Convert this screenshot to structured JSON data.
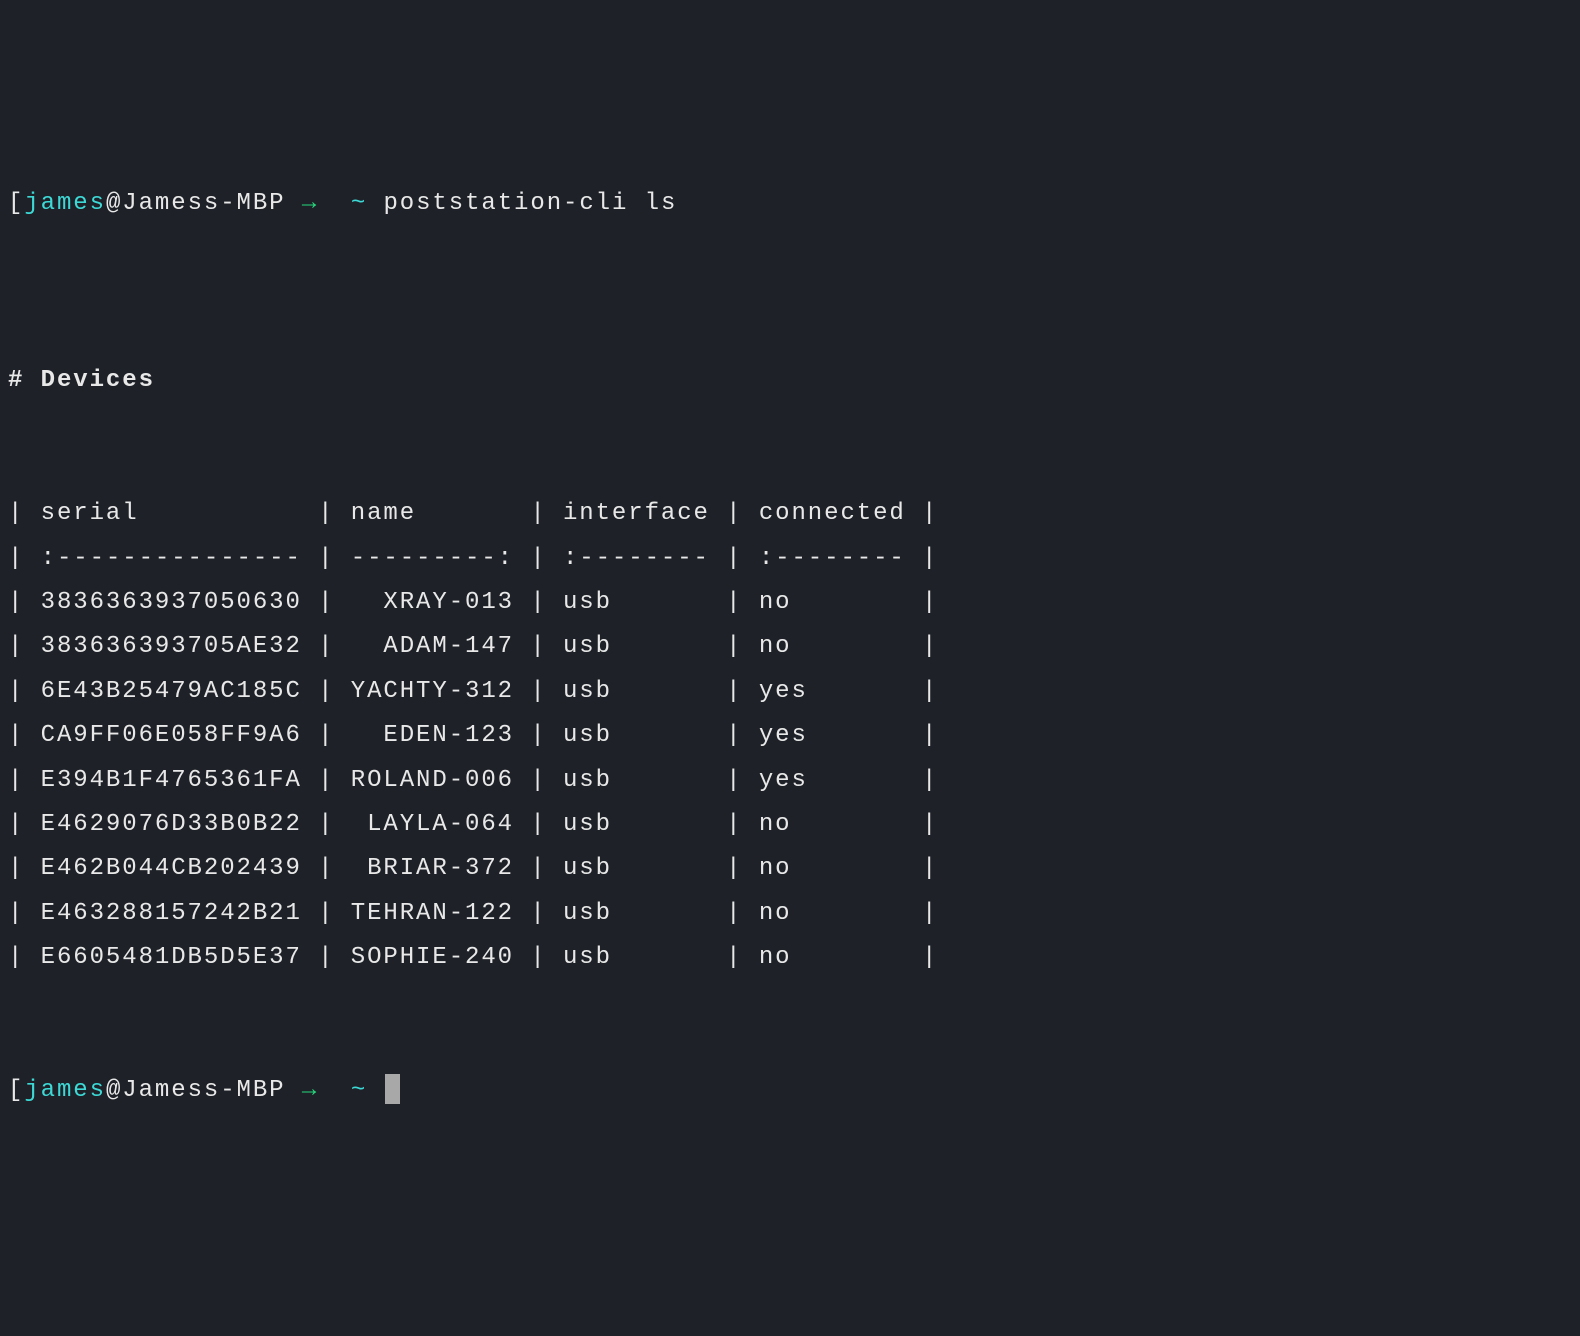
{
  "prompt1": {
    "open_bracket": "[",
    "user": "james",
    "at_host": "@Jamess-MBP",
    "arrow": "→",
    "tilde": "~",
    "command": "poststation-cli ls"
  },
  "heading": "# Devices",
  "table": {
    "header": "| serial           | name       | interface | connected |",
    "sep": "| :--------------- | ---------: | :-------- | :-------- |",
    "rows": [
      "| 3836363937050630 |   XRAY-013 | usb       | no        |",
      "| 383636393705AE32 |   ADAM-147 | usb       | no        |",
      "| 6E43B25479AC185C | YACHTY-312 | usb       | yes       |",
      "| CA9FF06E058FF9A6 |   EDEN-123 | usb       | yes       |",
      "| E394B1F4765361FA | ROLAND-006 | usb       | yes       |",
      "| E4629076D33B0B22 |  LAYLA-064 | usb       | no        |",
      "| E462B044CB202439 |  BRIAR-372 | usb       | no        |",
      "| E463288157242B21 | TEHRAN-122 | usb       | no        |",
      "| E6605481DB5D5E37 | SOPHIE-240 | usb       | no        |"
    ]
  },
  "prompt2": {
    "open_bracket": "[",
    "user": "james",
    "at_host": "@Jamess-MBP",
    "arrow": "→",
    "tilde": "~"
  }
}
